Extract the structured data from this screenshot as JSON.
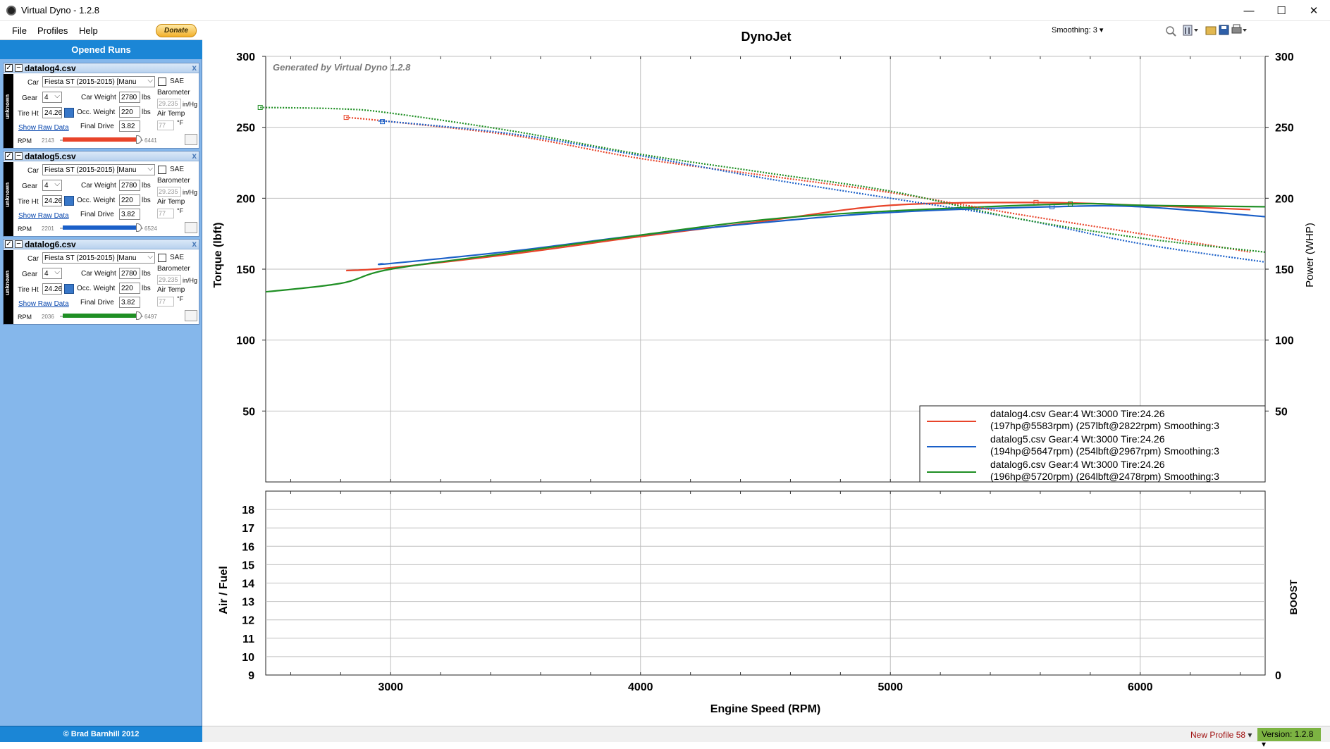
{
  "window": {
    "title": "Virtual Dyno - 1.2.8",
    "min": "—",
    "max": "☐",
    "close": "✕"
  },
  "menu": {
    "file": "File",
    "profiles": "Profiles",
    "help": "Help",
    "donate": "Donate"
  },
  "sidebar": {
    "header": "Opened Runs",
    "credit": "© Brad Barnhill 2012"
  },
  "runs": [
    {
      "file": "datalog4.csv",
      "tag": "unknown",
      "car": "Fiesta ST (2015-2015) [Manu",
      "gear": "4",
      "tire_ht": "24.26",
      "car_weight": "2780",
      "occ_weight": "220",
      "final_drive": "3.82",
      "sae": "SAE",
      "barometer_label": "Barometer",
      "barometer": "29.235",
      "baro_unit": "in/Hg",
      "airtemp_label": "Air Temp",
      "airtemp": "77",
      "temp_unit": "°F",
      "show_raw": "Show Raw Data",
      "rpm_label": "RPM",
      "rpm_min": "2143",
      "rpm_max": "6441",
      "color": "#e8442a"
    },
    {
      "file": "datalog5.csv",
      "tag": "unknown",
      "car": "Fiesta ST (2015-2015) [Manu",
      "gear": "4",
      "tire_ht": "24.26",
      "car_weight": "2780",
      "occ_weight": "220",
      "final_drive": "3.82",
      "sae": "SAE",
      "barometer_label": "Barometer",
      "barometer": "29.235",
      "baro_unit": "in/Hg",
      "airtemp_label": "Air Temp",
      "airtemp": "77",
      "temp_unit": "°F",
      "show_raw": "Show Raw Data",
      "rpm_label": "RPM",
      "rpm_min": "2201",
      "rpm_max": "6524",
      "color": "#1a5fc8"
    },
    {
      "file": "datalog6.csv",
      "tag": "unknown",
      "car": "Fiesta ST (2015-2015) [Manu",
      "gear": "4",
      "tire_ht": "24.26",
      "car_weight": "2780",
      "occ_weight": "220",
      "final_drive": "3.82",
      "sae": "SAE",
      "barometer_label": "Barometer",
      "barometer": "29.235",
      "baro_unit": "in/Hg",
      "airtemp_label": "Air Temp",
      "airtemp": "77",
      "temp_unit": "°F",
      "show_raw": "Show Raw Data",
      "rpm_label": "RPM",
      "rpm_min": "2036",
      "rpm_max": "6497",
      "color": "#1f8f24"
    }
  ],
  "labels": {
    "car": "Car",
    "gear": "Gear",
    "tire_ht": "Tire Ht",
    "car_weight": "Car Weight",
    "occ_weight": "Occ. Weight",
    "final_drive": "Final Drive",
    "lbs": "lbs"
  },
  "toolbar": {
    "smoothing": "Smoothing: 3"
  },
  "status": {
    "profile": "New Profile 58",
    "version": "Version: 1.2.8"
  },
  "chart_data": [
    {
      "type": "line",
      "title": "DynoJet",
      "watermark": "Generated by Virtual Dyno 1.2.8",
      "xlabel": "Engine Speed (RPM)",
      "ylabel": "Torque (lbft)",
      "y2label": "Power (WHP)",
      "xlim": [
        2500,
        6500
      ],
      "ylim": [
        0,
        300
      ],
      "xticks": [
        3000,
        4000,
        5000,
        6000
      ],
      "yticks": [
        50,
        100,
        150,
        200,
        250,
        300
      ],
      "grid": true,
      "legend_position": "bottom-right",
      "legend": [
        "datalog4.csv Gear:4 Wt:3000 Tire:24.26 (197hp@5583rpm) (257lbft@2822rpm) Smoothing:3",
        "datalog5.csv Gear:4 Wt:3000 Tire:24.26 (194hp@5647rpm) (254lbft@2967rpm) Smoothing:3",
        "datalog6.csv Gear:4 Wt:3000 Tire:24.26 (196hp@5720rpm) (264lbft@2478rpm) Smoothing:3"
      ],
      "series": [
        {
          "name": "datalog4.csv",
          "kind": "power",
          "color": "#e8442a",
          "x": [
            2822,
            3000,
            3500,
            4000,
            4500,
            5000,
            5583,
            6000,
            6441
          ],
          "y": [
            149,
            151,
            161,
            173,
            184,
            195,
            197,
            195,
            192
          ]
        },
        {
          "name": "datalog5.csv",
          "kind": "power",
          "color": "#1a5fc8",
          "x": [
            2967,
            3000,
            3500,
            4000,
            4500,
            5000,
            5647,
            6000,
            6500
          ],
          "y": [
            154,
            154,
            163,
            174,
            183,
            190,
            194,
            194,
            187
          ]
        },
        {
          "name": "datalog6.csv",
          "kind": "power",
          "color": "#1f8f24",
          "x": [
            2500,
            2800,
            3000,
            3500,
            4000,
            4500,
            5000,
            5720,
            6000,
            6500
          ],
          "y": [
            134,
            140,
            150,
            162,
            174,
            185,
            191,
            196,
            195,
            194
          ]
        },
        {
          "name": "datalog4.csv",
          "kind": "torque",
          "color": "#e8442a",
          "x": [
            2822,
            3000,
            3500,
            4000,
            4500,
            5000,
            5500,
            6000,
            6441
          ],
          "y": [
            257,
            254,
            244,
            228,
            216,
            204,
            189,
            175,
            162
          ]
        },
        {
          "name": "datalog5.csv",
          "kind": "torque",
          "color": "#1a5fc8",
          "x": [
            2967,
            3000,
            3500,
            4000,
            4500,
            5000,
            5500,
            6000,
            6500
          ],
          "y": [
            254,
            254,
            245,
            230,
            214,
            200,
            186,
            168,
            155
          ]
        },
        {
          "name": "datalog6.csv",
          "kind": "torque",
          "color": "#1f8f24",
          "x": [
            2478,
            2800,
            3000,
            3500,
            4000,
            4500,
            5000,
            5500,
            6000,
            6500
          ],
          "y": [
            264,
            263,
            260,
            247,
            231,
            218,
            205,
            186,
            172,
            162
          ]
        }
      ]
    },
    {
      "type": "line",
      "ylabel": "Air / Fuel",
      "y2label": "BOOST",
      "xlim": [
        2500,
        6500
      ],
      "ylim": [
        9,
        19
      ],
      "yticks": [
        9,
        10,
        11,
        12,
        13,
        14,
        15,
        16,
        17,
        18
      ],
      "y2ticks": [
        0
      ],
      "grid": true,
      "series": []
    }
  ]
}
